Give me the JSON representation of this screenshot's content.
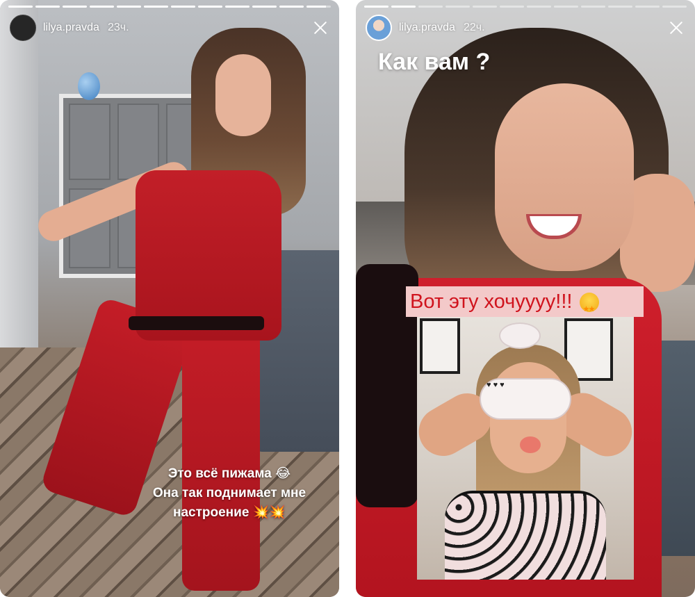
{
  "stories": [
    {
      "id": "left",
      "progress": [
        1,
        1,
        1,
        1,
        1,
        1,
        1,
        1,
        1,
        1,
        1,
        0.8
      ],
      "user": {
        "username": "lilya.pravda",
        "timestamp": "23ч."
      },
      "caption_lines": [
        "Это всё пижама 😂",
        "Она так  поднимает мне",
        "настроение 💥💥"
      ]
    },
    {
      "id": "right",
      "progress": [
        1,
        1,
        0,
        0,
        0,
        0,
        0,
        0,
        0,
        0,
        0,
        0
      ],
      "user": {
        "username": "lilya.pravda",
        "timestamp": "22ч."
      },
      "question": "Как вам ?",
      "want_label": "Вот эту хочуууу!!!",
      "want_emoji": "star-struck-emoji"
    }
  ],
  "icons": {
    "close": "close-icon",
    "avatar": "avatar"
  },
  "colors": {
    "pajama_red": "#c21f28",
    "label_bg": "#f3c9c9",
    "label_text": "#d0131d"
  }
}
